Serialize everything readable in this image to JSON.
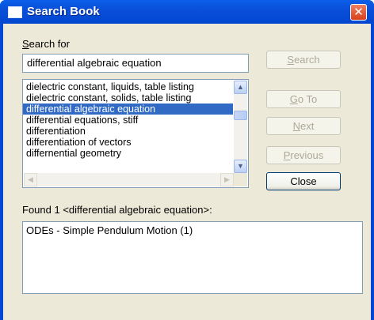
{
  "window": {
    "title": "Search Book",
    "close_glyph": "✕"
  },
  "search": {
    "label_prefix": "",
    "label_mnemonic": "S",
    "label_rest": "earch for",
    "value": "differential algebraic equation"
  },
  "topics": {
    "items": [
      "dielectric constant, liquids, table listing",
      "dielectric constant, solids, table listing",
      "differential algebraic equation",
      "differential equations, stiff",
      "differentiation",
      "differentiation of vectors",
      "differnential geometry"
    ],
    "selected_index": 2
  },
  "buttons": {
    "search": {
      "mnemonic": "S",
      "rest": "earch",
      "enabled": false
    },
    "goto": {
      "mnemonic": "G",
      "rest": "o To",
      "enabled": false
    },
    "next": {
      "mnemonic": "N",
      "rest": "ext",
      "enabled": false
    },
    "previous": {
      "mnemonic": "P",
      "rest": "revious",
      "enabled": false
    },
    "close": {
      "label": "Close",
      "enabled": true
    }
  },
  "results": {
    "found_label": "Found 1  <differential algebraic equation>:",
    "items": [
      "ODEs - Simple Pendulum Motion  (1)"
    ]
  },
  "colors": {
    "title_bar": "#0a5fe8",
    "selection": "#316ac5",
    "dialog_face": "#ece9d8"
  }
}
